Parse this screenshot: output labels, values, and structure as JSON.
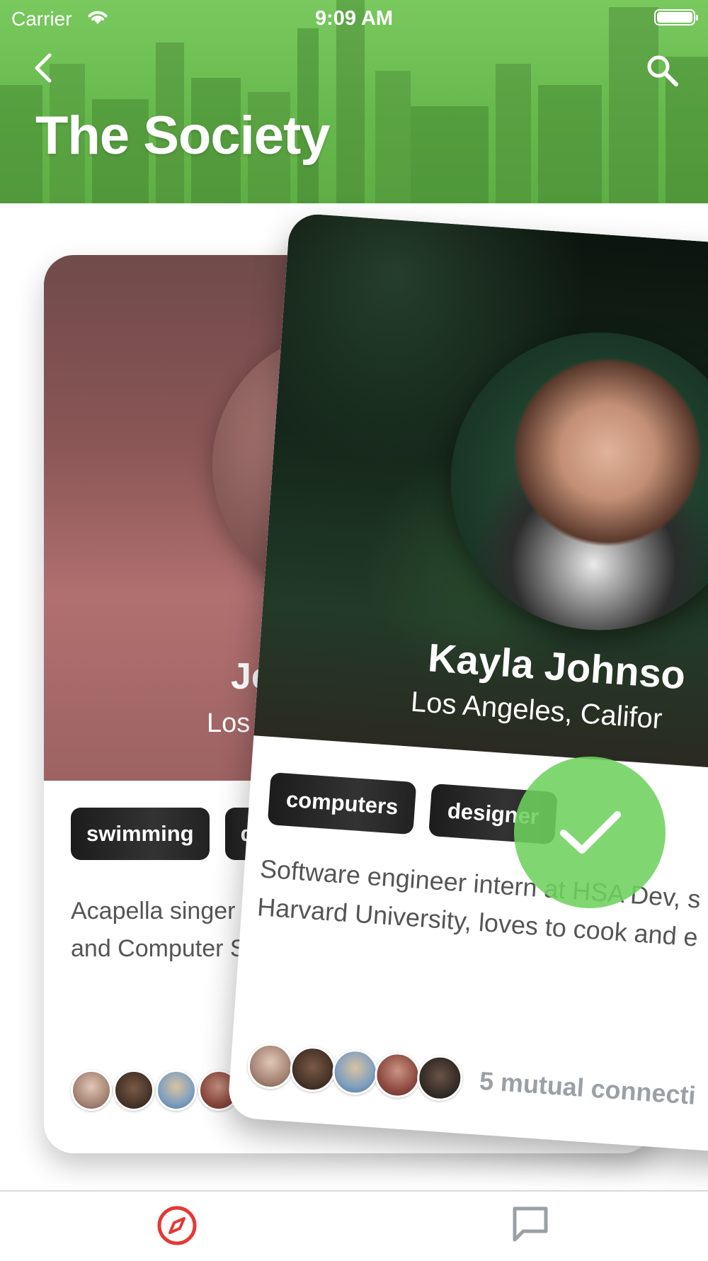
{
  "status_bar": {
    "carrier": "Carrier",
    "time": "9:09 AM"
  },
  "header": {
    "title": "The Society",
    "back_icon": "chevron-left-icon",
    "search_icon": "search-icon"
  },
  "cards": [
    {
      "name": "Jef",
      "location": "Los A",
      "tags": [
        "swimming",
        "de"
      ],
      "description": [
        "Acapella singer at",
        "and Computer Sc"
      ]
    },
    {
      "name": "Kayla Johnso",
      "location": "Los Angeles, Califor",
      "tags": [
        "computers",
        "designer"
      ],
      "description": [
        "Software engineer intern at HSA Dev, s",
        "Harvard University, loves to cook and e"
      ],
      "mutual_text": "5 mutual connecti"
    }
  ],
  "like_indicator": {
    "icon": "checkmark-icon",
    "color": "#6ed25f"
  },
  "tab_bar": {
    "items": [
      {
        "icon": "compass-icon",
        "active": true,
        "color": "#e53935"
      },
      {
        "icon": "chat-bubble-icon",
        "active": false,
        "color": "#9aa0a6"
      }
    ]
  }
}
